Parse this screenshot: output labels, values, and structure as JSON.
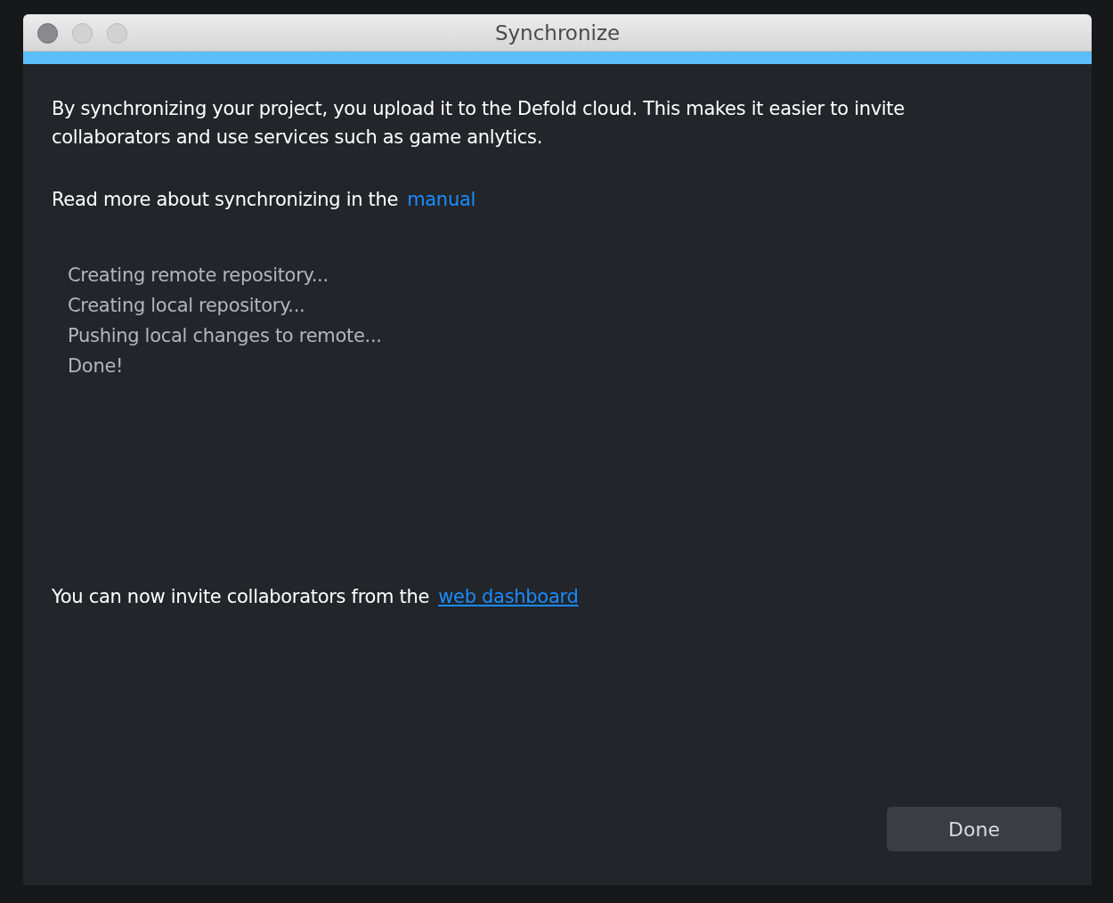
{
  "window": {
    "title": "Synchronize"
  },
  "intro": "By synchronizing your project, you upload it to the Defold cloud. This makes it easier to invite collaborators and use services such as game anlytics.",
  "read_more": {
    "text": "Read more about synchronizing in the",
    "link": "manual"
  },
  "log": [
    "Creating remote repository...",
    "Creating local repository...",
    "Pushing local changes to remote...",
    "Done!"
  ],
  "invite": {
    "text": "You can now invite collaborators from the",
    "link": "web dashboard"
  },
  "buttons": [
    "Done"
  ]
}
